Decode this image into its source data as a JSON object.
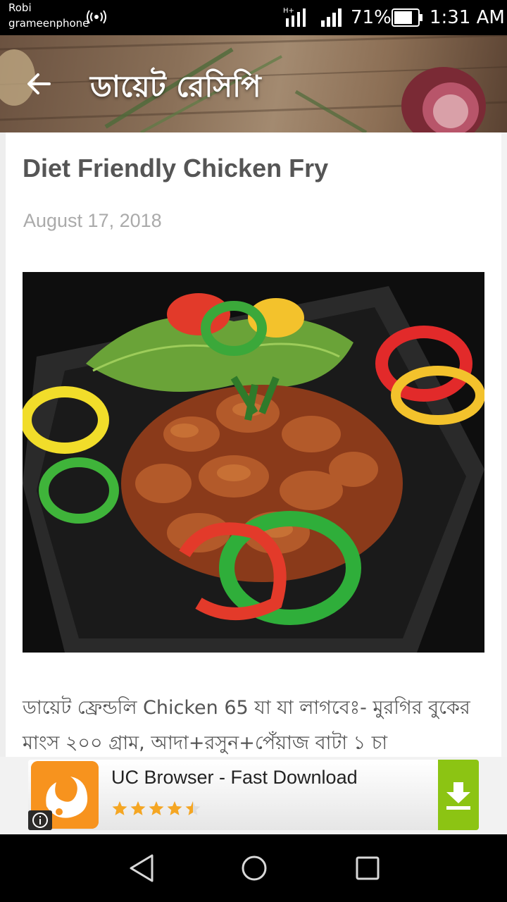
{
  "status_bar": {
    "carrier": "Robi",
    "operator": "grameenphone",
    "network_type": "H+",
    "battery_percent": "71%",
    "time": "1:31 AM"
  },
  "toolbar": {
    "back_icon": "back-arrow-icon",
    "title": "ডায়েট রেসিপি"
  },
  "post": {
    "title": "Diet Friendly Chicken Fry",
    "date": "August 17, 2018",
    "image_icon": "chicken-fry-photo",
    "body": "ডায়েট ফ্রেন্ডলি Chicken 65 যা যা লাগবেঃ- মুরগির বুকের মাংস ২০০ গ্রাম, আদা+রসুন+পেঁয়াজ বাটা ১ চা"
  },
  "ad": {
    "title": "UC Browser - Fast Download",
    "rating": 4.5,
    "app_icon": "uc-browser-icon",
    "info_icon": "info-icon",
    "download_icon": "download-icon",
    "colors": {
      "download_button": "#8cc413",
      "app_icon_bg": "#f7931e",
      "star": "#f5a623"
    }
  },
  "nav_bar": {
    "back_icon": "triangle-back-icon",
    "home_icon": "circle-home-icon",
    "recents_icon": "square-recents-icon"
  }
}
